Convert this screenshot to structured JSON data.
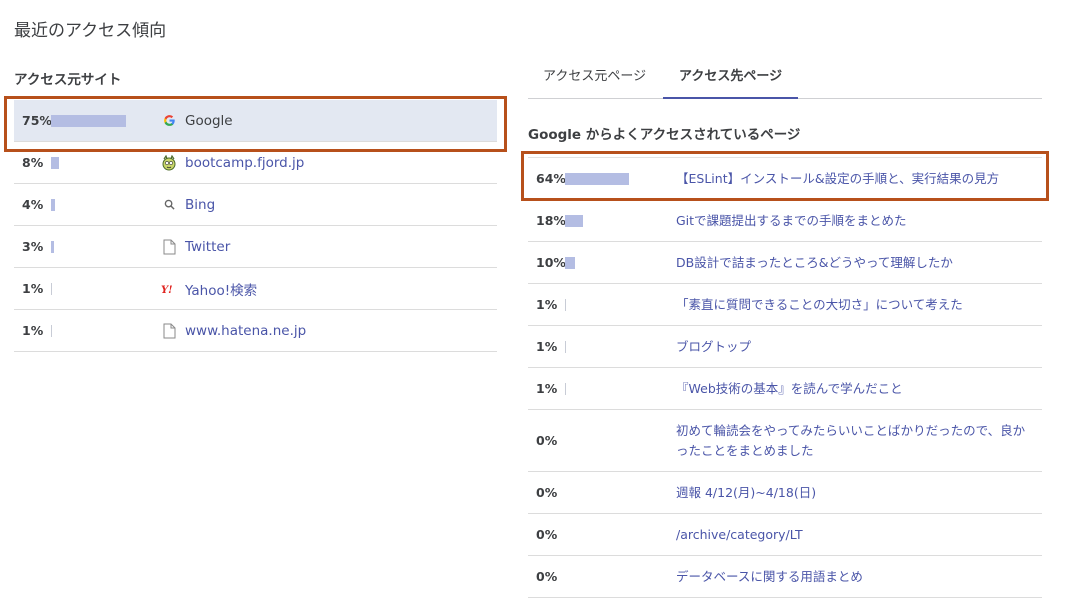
{
  "page_title": "最近のアクセス傾向",
  "sources": {
    "heading": "アクセス元サイト",
    "items": [
      {
        "percent": "75%",
        "share": 0.75,
        "name": "Google",
        "icon": "google-icon"
      },
      {
        "percent": "8%",
        "share": 0.08,
        "name": "bootcamp.fjord.jp",
        "icon": "fjord-icon"
      },
      {
        "percent": "4%",
        "share": 0.04,
        "name": "Bing",
        "icon": "search-icon"
      },
      {
        "percent": "3%",
        "share": 0.03,
        "name": "Twitter",
        "icon": "document-icon"
      },
      {
        "percent": "1%",
        "share": 0.01,
        "name": "Yahoo!検索",
        "icon": "yahoo-icon"
      },
      {
        "percent": "1%",
        "share": 0.01,
        "name": "www.hatena.ne.jp",
        "icon": "document-icon"
      }
    ]
  },
  "tabs": [
    {
      "label": "アクセス元ページ",
      "active": false
    },
    {
      "label": "アクセス先ページ",
      "active": true
    }
  ],
  "pages": {
    "heading": "Google からよくアクセスされているページ",
    "items": [
      {
        "percent": "64%",
        "share": 0.64,
        "title": "【ESLint】インストール&設定の手順と、実行結果の見方"
      },
      {
        "percent": "18%",
        "share": 0.18,
        "title": "Gitで課題提出するまでの手順をまとめた"
      },
      {
        "percent": "10%",
        "share": 0.1,
        "title": "DB設計で詰まったところ&どうやって理解したか"
      },
      {
        "percent": "1%",
        "share": 0.01,
        "title": "「素直に質問できることの大切さ」について考えた"
      },
      {
        "percent": "1%",
        "share": 0.01,
        "title": "ブログトップ"
      },
      {
        "percent": "1%",
        "share": 0.01,
        "title": "『Web技術の基本』を読んで学んだこと"
      },
      {
        "percent": "0%",
        "share": 0,
        "title": "初めて輪読会をやってみたらいいことばかりだったので、良かったことをまとめました"
      },
      {
        "percent": "0%",
        "share": 0,
        "title": "週報 4/12(月)~4/18(日)"
      },
      {
        "percent": "0%",
        "share": 0,
        "title": "/archive/category/LT"
      },
      {
        "percent": "0%",
        "share": 0,
        "title": "データベースに関する用語まとめ"
      }
    ]
  },
  "colors": {
    "link": "#4a55a8",
    "bar": "#b4bde3",
    "selected_row": "#e3e8f2",
    "highlight": "#b7501b"
  }
}
